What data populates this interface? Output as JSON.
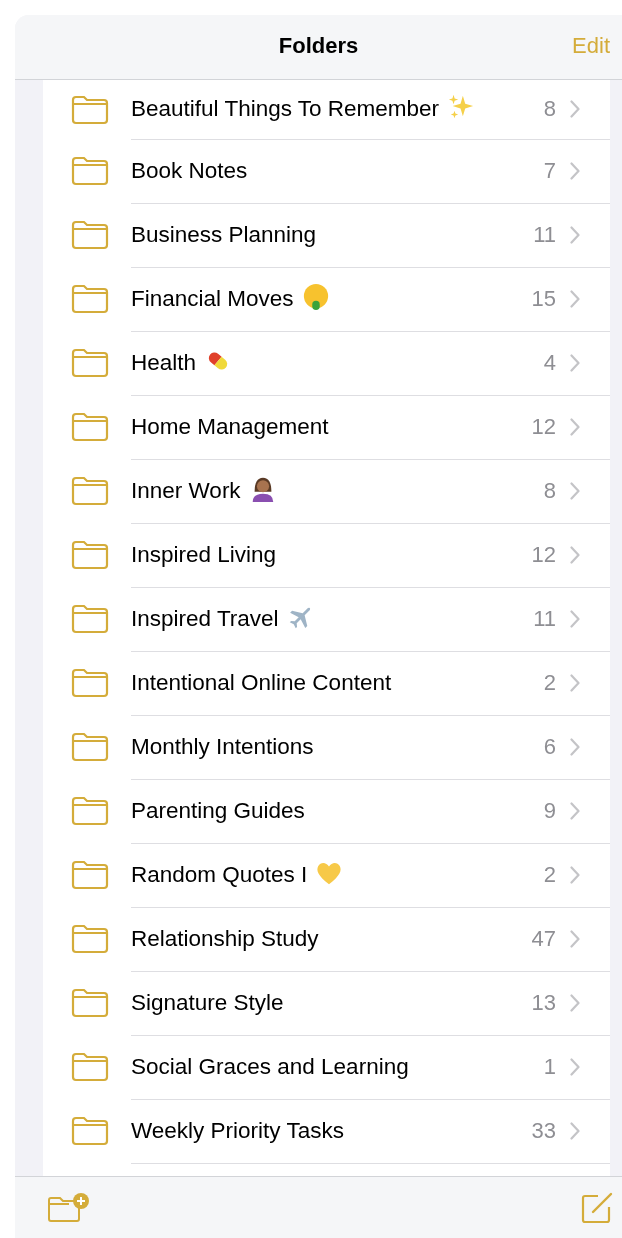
{
  "header": {
    "title": "Folders",
    "edit_button": "Edit"
  },
  "folders": [
    {
      "name": "Beautiful Things To Remember",
      "kind": "sparkles",
      "count": "8"
    },
    {
      "name": "Book Notes",
      "count": "7"
    },
    {
      "name": "Business Planning",
      "count": "11"
    },
    {
      "name": "Financial Moves",
      "kind": "money-face",
      "count": "15"
    },
    {
      "name": "Health",
      "kind": "pill",
      "count": "4"
    },
    {
      "name": "Home Management",
      "count": "12"
    },
    {
      "name": "Inner Work",
      "kind": "person",
      "count": "8"
    },
    {
      "name": "Inspired Living",
      "count": "12"
    },
    {
      "name": "Inspired Travel",
      "kind": "airplane",
      "count": "11"
    },
    {
      "name": "Intentional Online Content",
      "count": "2"
    },
    {
      "name": "Monthly Intentions",
      "count": "6"
    },
    {
      "name": "Parenting Guides",
      "count": "9"
    },
    {
      "name": "Random Quotes I",
      "kind": "heart",
      "count": "2"
    },
    {
      "name": "Relationship Study",
      "count": "47"
    },
    {
      "name": "Signature Style",
      "count": "13"
    },
    {
      "name": "Social Graces and Learning",
      "count": "1"
    },
    {
      "name": "Weekly Priority Tasks",
      "count": "33"
    }
  ]
}
